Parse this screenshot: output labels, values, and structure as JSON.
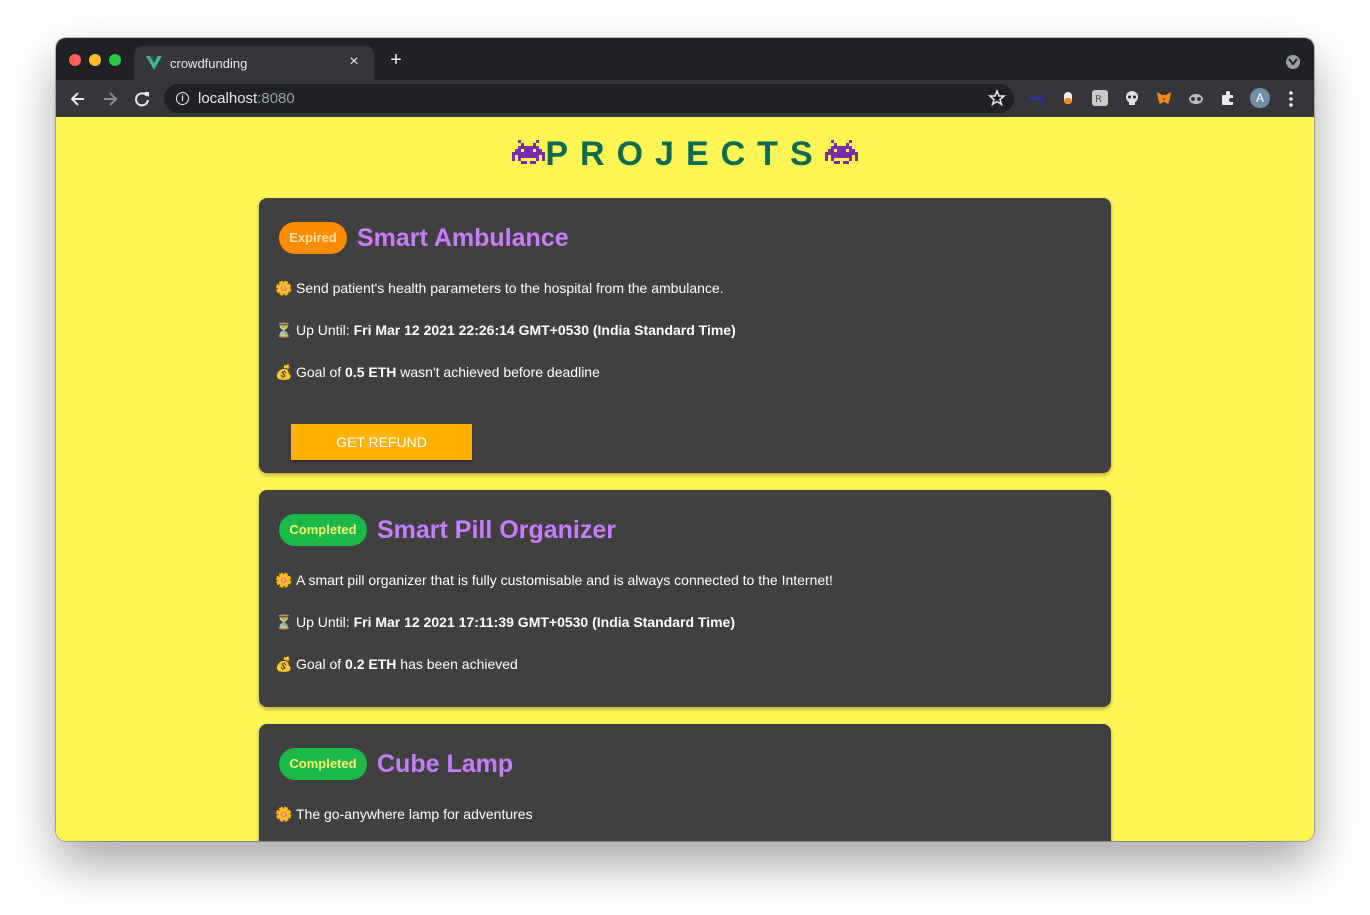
{
  "browser": {
    "tab_title": "crowdfunding",
    "tab_close": "×",
    "new_tab": "+",
    "url_host": "localhost",
    "url_port": ":8080",
    "avatar_letter": "A",
    "extensions": [
      "lastpass-icon",
      "pill-icon",
      "translate-icon",
      "ghost-icon",
      "metamask-icon",
      "mask-icon",
      "puzzle-icon"
    ]
  },
  "page": {
    "heading": "PROJECTS",
    "heading_color": "#0b6b52",
    "background": "#fff655"
  },
  "projects": [
    {
      "status": "Expired",
      "title": "Smart Ambulance",
      "description": "Send patient's health parameters to the hospital from the ambulance.",
      "deadline_label": "Up Until:",
      "deadline": "Fri Mar 12 2021 22:26:14 GMT+0530 (India Standard Time)",
      "goal_prefix": "Goal of",
      "goal_amount": "0.5 ETH",
      "goal_suffix": "wasn't achieved before deadline",
      "action": "GET REFUND"
    },
    {
      "status": "Completed",
      "title": "Smart Pill Organizer",
      "description": "A smart pill organizer that is fully customisable and is always connected to the Internet!",
      "deadline_label": "Up Until:",
      "deadline": "Fri Mar 12 2021 17:11:39 GMT+0530 (India Standard Time)",
      "goal_prefix": "Goal of",
      "goal_amount": "0.2 ETH",
      "goal_suffix": "has been achieved"
    },
    {
      "status": "Completed",
      "title": "Cube Lamp",
      "description": "The go-anywhere lamp for adventures"
    }
  ]
}
